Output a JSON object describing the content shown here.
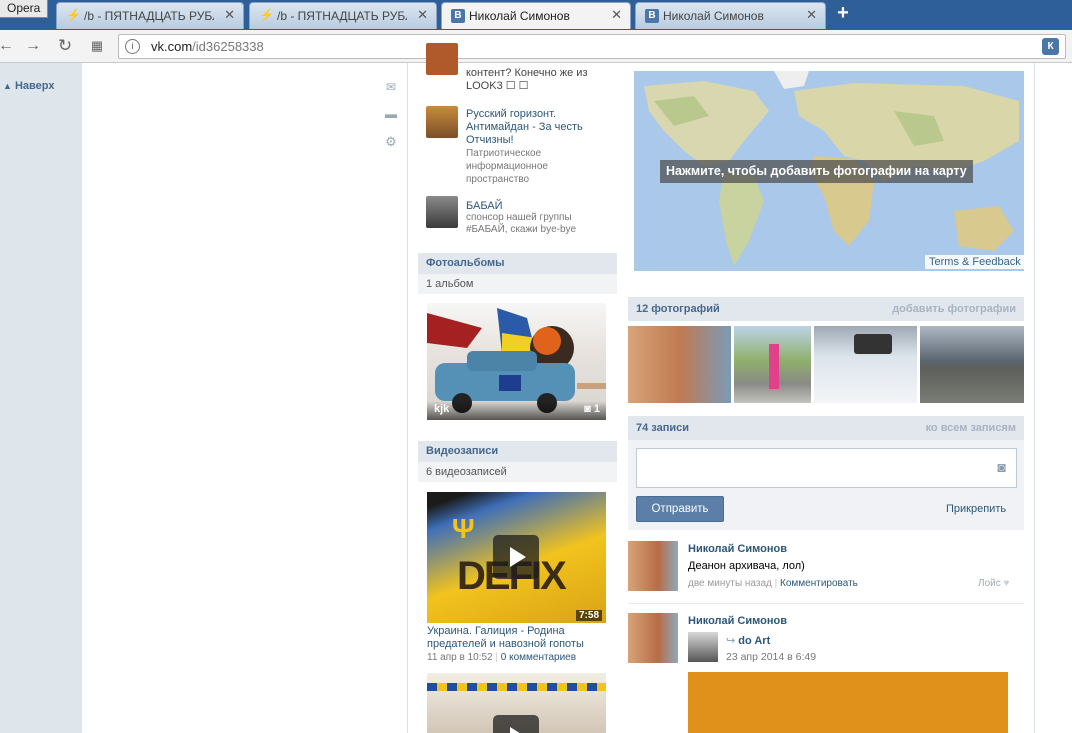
{
  "browser": {
    "opera_label": "Opera",
    "tabs": [
      {
        "title": "/b - ПЯТНАДЦАТЬ РУБЛЕ",
        "icon": "bolt-icon"
      },
      {
        "title": "/b - ПЯТНАДЦАТЬ РУБЛЕ",
        "icon": "bolt-icon"
      },
      {
        "title": "Николай Симонов",
        "icon": "vk-icon"
      },
      {
        "title": "Николай Симонов",
        "icon": "vk-icon"
      }
    ],
    "close_glyph": "✕",
    "new_tab_glyph": "+",
    "url_host": "vk.com",
    "url_path": "/id36258338",
    "ext_glyph": "К"
  },
  "sidebar": {
    "up_label": "Наверх"
  },
  "groups": [
    {
      "title": "контент? Конечно же из LOOK3 ☐ ☐",
      "desc": ""
    },
    {
      "title": "Русский горизонт. Антимайдан - За честь Отчизны!",
      "desc": "Патриотическое информационное пространство"
    },
    {
      "title": "БАБАЙ",
      "desc": "спонсор нашей группы #БАБАЙ, скажи bye-bye"
    }
  ],
  "albums": {
    "header": "Фотоальбомы",
    "count": "1 альбом",
    "album_name": "kjk",
    "album_photos": "1"
  },
  "videos": {
    "header": "Видеозаписи",
    "count": "6 видеозаписей",
    "duration": "7:58",
    "title": "Украина. Галиция - Родина предателей и навозной гопоты",
    "date": "11 апр в 10:52",
    "comments": "0 комментариев",
    "overlay_text": "DEFIX"
  },
  "map": {
    "label": "Нажмите, чтобы добавить фотографии на карту",
    "terms": "Terms & Feedback"
  },
  "photos": {
    "count": "12 фотографий",
    "add": "добавить фотографии"
  },
  "wall": {
    "count": "74 записи",
    "all": "ко всем записям",
    "send": "Отправить",
    "attach": "Прикрепить",
    "post1": {
      "author": "Николай Симонов",
      "text": "Деанон архивача, лол)",
      "time": "две минуты назад",
      "comment": "Комментировать",
      "like": "Лойс"
    },
    "post2": {
      "author": "Николай Симонов",
      "repost_from": "do Art",
      "date": "23 апр 2014 в 6:49"
    }
  },
  "colors": {
    "vk_blue": "#4a76a8",
    "link": "#2b587a",
    "header_bg": "#e1e7ed",
    "tabbar": "#2f5f99"
  }
}
